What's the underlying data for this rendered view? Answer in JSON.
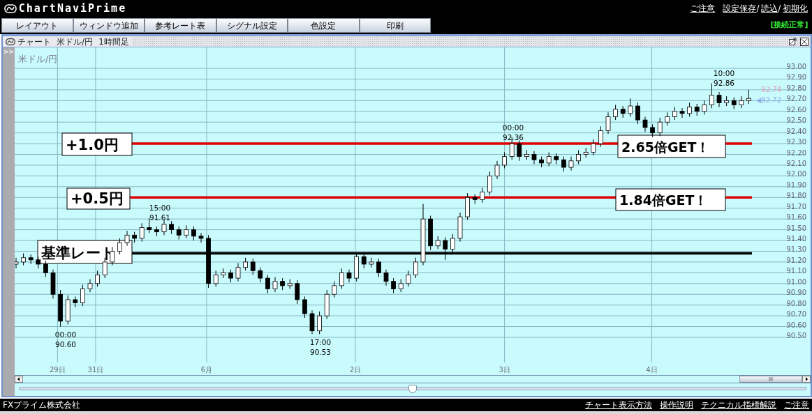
{
  "header": {
    "logo": "ChartNaviPrime",
    "links": [
      {
        "label": "ご注意"
      },
      {
        "label": "設定保存",
        "suffix": "/"
      },
      {
        "label": "読込",
        "suffix": "/"
      },
      {
        "label": "初期化"
      }
    ],
    "status": "[接続正常]"
  },
  "menu": [
    "レイアウト",
    "ウィンドウ追加",
    "参考レート表",
    "シグナル設定",
    "色設定",
    "印刷"
  ],
  "chart_window": {
    "title_parts": [
      "チャート",
      "米ドル/円",
      "1時間足"
    ],
    "panel_toggle": ">>",
    "symbol": "米ドル/円",
    "chart_data": {
      "type": "candlestick",
      "ohlc": [
        [
          91.18,
          91.24,
          91.14,
          91.2
        ],
        [
          91.2,
          91.28,
          91.17,
          91.24
        ],
        [
          91.24,
          91.27,
          91.18,
          91.22
        ],
        [
          91.22,
          91.25,
          91.14,
          91.18
        ],
        [
          91.18,
          91.21,
          91.06,
          91.1
        ],
        [
          91.1,
          91.13,
          90.86,
          90.9
        ],
        [
          90.9,
          90.94,
          90.6,
          90.65
        ],
        [
          90.65,
          90.89,
          90.62,
          90.85
        ],
        [
          90.85,
          90.88,
          90.78,
          90.82
        ],
        [
          90.82,
          90.99,
          90.79,
          90.95
        ],
        [
          90.95,
          91.04,
          90.92,
          91.0
        ],
        [
          91.0,
          91.12,
          90.97,
          91.08
        ],
        [
          91.08,
          91.24,
          91.05,
          91.2
        ],
        [
          91.2,
          91.34,
          91.17,
          91.3
        ],
        [
          91.3,
          91.42,
          91.27,
          91.38
        ],
        [
          91.38,
          91.49,
          91.35,
          91.45
        ],
        [
          91.45,
          91.48,
          91.38,
          91.42
        ],
        [
          91.42,
          91.56,
          91.39,
          91.52
        ],
        [
          91.52,
          91.61,
          91.47,
          91.5
        ],
        [
          91.5,
          91.53,
          91.44,
          91.48
        ],
        [
          91.48,
          91.59,
          91.45,
          91.55
        ],
        [
          91.55,
          91.58,
          91.46,
          91.5
        ],
        [
          91.5,
          91.53,
          91.41,
          91.45
        ],
        [
          91.45,
          91.54,
          91.42,
          91.5
        ],
        [
          91.5,
          91.53,
          91.4,
          91.44
        ],
        [
          91.44,
          91.47,
          91.38,
          91.42
        ],
        [
          91.42,
          91.45,
          90.96,
          91.0
        ],
        [
          91.0,
          91.12,
          90.97,
          91.08
        ],
        [
          91.08,
          91.14,
          91.05,
          91.1
        ],
        [
          91.1,
          91.13,
          91.01,
          91.05
        ],
        [
          91.05,
          91.19,
          91.02,
          91.15
        ],
        [
          91.15,
          91.24,
          91.12,
          91.2
        ],
        [
          91.2,
          91.23,
          91.08,
          91.12
        ],
        [
          91.12,
          91.15,
          91.01,
          91.05
        ],
        [
          91.05,
          91.08,
          90.91,
          90.95
        ],
        [
          90.95,
          91.06,
          90.92,
          91.02
        ],
        [
          91.02,
          91.05,
          90.94,
          90.98
        ],
        [
          90.98,
          91.04,
          90.95,
          91.0
        ],
        [
          91.0,
          91.03,
          90.81,
          90.85
        ],
        [
          90.85,
          90.88,
          90.68,
          90.72
        ],
        [
          90.72,
          90.75,
          90.53,
          90.56
        ],
        [
          90.56,
          90.74,
          90.53,
          90.7
        ],
        [
          90.7,
          90.94,
          90.67,
          90.9
        ],
        [
          90.9,
          91.02,
          90.87,
          90.98
        ],
        [
          90.98,
          91.14,
          90.95,
          91.1
        ],
        [
          91.1,
          91.13,
          91.01,
          91.05
        ],
        [
          91.05,
          91.29,
          91.02,
          91.25
        ],
        [
          91.25,
          91.28,
          91.14,
          91.18
        ],
        [
          91.18,
          91.24,
          91.15,
          91.2
        ],
        [
          91.2,
          91.23,
          91.06,
          91.1
        ],
        [
          91.1,
          91.13,
          90.98,
          91.02
        ],
        [
          91.02,
          91.05,
          90.91,
          90.95
        ],
        [
          90.95,
          91.04,
          90.92,
          91.0
        ],
        [
          91.0,
          91.12,
          90.97,
          91.08
        ],
        [
          91.08,
          91.24,
          91.05,
          91.2
        ],
        [
          91.2,
          91.74,
          91.17,
          91.6
        ],
        [
          91.6,
          91.63,
          91.31,
          91.35
        ],
        [
          91.35,
          91.44,
          91.32,
          91.4
        ],
        [
          91.4,
          91.43,
          91.22,
          91.32
        ],
        [
          91.32,
          91.46,
          91.29,
          91.42
        ],
        [
          91.42,
          91.66,
          91.39,
          91.62
        ],
        [
          91.62,
          91.84,
          91.59,
          91.8
        ],
        [
          91.8,
          91.83,
          91.74,
          91.78
        ],
        [
          91.78,
          91.89,
          91.75,
          91.85
        ],
        [
          91.85,
          92.04,
          91.82,
          92.0
        ],
        [
          92.0,
          92.14,
          91.97,
          92.1
        ],
        [
          92.1,
          92.22,
          92.07,
          92.18
        ],
        [
          92.18,
          92.36,
          92.15,
          92.3
        ],
        [
          92.3,
          92.33,
          92.14,
          92.18
        ],
        [
          92.18,
          92.24,
          92.15,
          92.2
        ],
        [
          92.2,
          92.23,
          92.11,
          92.15
        ],
        [
          92.15,
          92.18,
          92.08,
          92.12
        ],
        [
          92.12,
          92.22,
          92.09,
          92.18
        ],
        [
          92.18,
          92.21,
          92.11,
          92.15
        ],
        [
          92.15,
          92.18,
          92.04,
          92.08
        ],
        [
          92.08,
          92.18,
          92.05,
          92.14
        ],
        [
          92.14,
          92.24,
          92.11,
          92.2
        ],
        [
          92.2,
          92.26,
          92.17,
          92.22
        ],
        [
          92.22,
          92.34,
          92.19,
          92.3
        ],
        [
          92.3,
          92.46,
          92.27,
          92.42
        ],
        [
          92.42,
          92.59,
          92.39,
          92.55
        ],
        [
          92.55,
          92.66,
          92.52,
          92.62
        ],
        [
          92.62,
          92.65,
          92.54,
          92.58
        ],
        [
          92.58,
          92.72,
          92.55,
          92.65
        ],
        [
          92.65,
          92.68,
          92.48,
          92.52
        ],
        [
          92.52,
          92.55,
          92.41,
          92.45
        ],
        [
          92.45,
          92.48,
          92.36,
          92.4
        ],
        [
          92.4,
          92.54,
          92.37,
          92.5
        ],
        [
          92.5,
          92.59,
          92.47,
          92.55
        ],
        [
          92.55,
          92.64,
          92.52,
          92.6
        ],
        [
          92.6,
          92.63,
          92.54,
          92.58
        ],
        [
          92.58,
          92.68,
          92.55,
          92.64
        ],
        [
          92.64,
          92.67,
          92.56,
          92.6
        ],
        [
          92.6,
          92.7,
          92.57,
          92.66
        ],
        [
          92.66,
          92.86,
          92.63,
          92.75
        ],
        [
          92.75,
          92.78,
          92.64,
          92.68
        ],
        [
          92.68,
          92.74,
          92.65,
          92.7
        ],
        [
          92.7,
          92.73,
          92.62,
          92.66
        ],
        [
          92.66,
          92.74,
          92.63,
          92.7
        ],
        [
          92.7,
          92.8,
          92.67,
          92.72
        ]
      ],
      "ylim": [
        90.5,
        93.0
      ],
      "grid": true,
      "yticks": [
        {
          "value": 93.0,
          "label": "93.00"
        },
        {
          "value": 92.9,
          "label": "92.90"
        },
        {
          "value": 92.8,
          "label": "92.80"
        },
        {
          "value": 92.7,
          "label": "92.70"
        },
        {
          "value": 92.6,
          "label": "92.60"
        },
        {
          "value": 92.5,
          "label": "92.50"
        },
        {
          "value": 92.4,
          "label": "92.40"
        },
        {
          "value": 92.3,
          "label": "92.30"
        },
        {
          "value": 92.2,
          "label": "92.20"
        },
        {
          "value": 92.1,
          "label": "92.10"
        },
        {
          "value": 92.0,
          "label": "92.00"
        },
        {
          "value": 91.9,
          "label": "91.90"
        },
        {
          "value": 91.8,
          "label": "91.80"
        },
        {
          "value": 91.7,
          "label": "91.70"
        },
        {
          "value": 91.6,
          "label": "91.60"
        },
        {
          "value": 91.5,
          "label": "91.50"
        },
        {
          "value": 91.4,
          "label": "91.40"
        },
        {
          "value": 91.3,
          "label": "91.30"
        },
        {
          "value": 91.2,
          "label": "91.20"
        },
        {
          "value": 91.1,
          "label": "91.10"
        },
        {
          "value": 91.0,
          "label": "91.00"
        },
        {
          "value": 90.9,
          "label": "90.90"
        },
        {
          "value": 90.8,
          "label": "90.80"
        },
        {
          "value": 90.7,
          "label": "90.70"
        },
        {
          "value": 90.6,
          "label": "90.60"
        },
        {
          "value": 90.5,
          "label": "90.50"
        }
      ]
    },
    "x_axis": [
      "29日",
      "31日",
      "6月",
      "2日",
      "3日",
      "4日"
    ],
    "levels": [
      {
        "label": "+1.0円",
        "kind": "target"
      },
      {
        "label": "+0.5円",
        "kind": "target"
      },
      {
        "label": "基準レート",
        "kind": "base"
      }
    ],
    "gains": [
      "2.65倍GET！",
      "1.84倍GET！"
    ],
    "annotations": [
      {
        "time": "15:00",
        "price": "91.61"
      },
      {
        "time": "00:00",
        "price": "92.36"
      },
      {
        "time": "10:00",
        "price": "92.86"
      },
      {
        "time": "00:00",
        "price": "90.60"
      },
      {
        "time": "17:00",
        "price": "90.53"
      }
    ],
    "price_markers": [
      {
        "text": "92.74",
        "color": "#e39ab8"
      },
      {
        "text": "◀92.72",
        "color": "#93aee6"
      }
    ],
    "zoom_slider": {
      "level": 0.5
    }
  },
  "footer": {
    "company": "FXプライム株式会社",
    "links": [
      "チャート表示方法",
      "操作説明",
      "テクニカル指標解説",
      "ご注意"
    ]
  }
}
